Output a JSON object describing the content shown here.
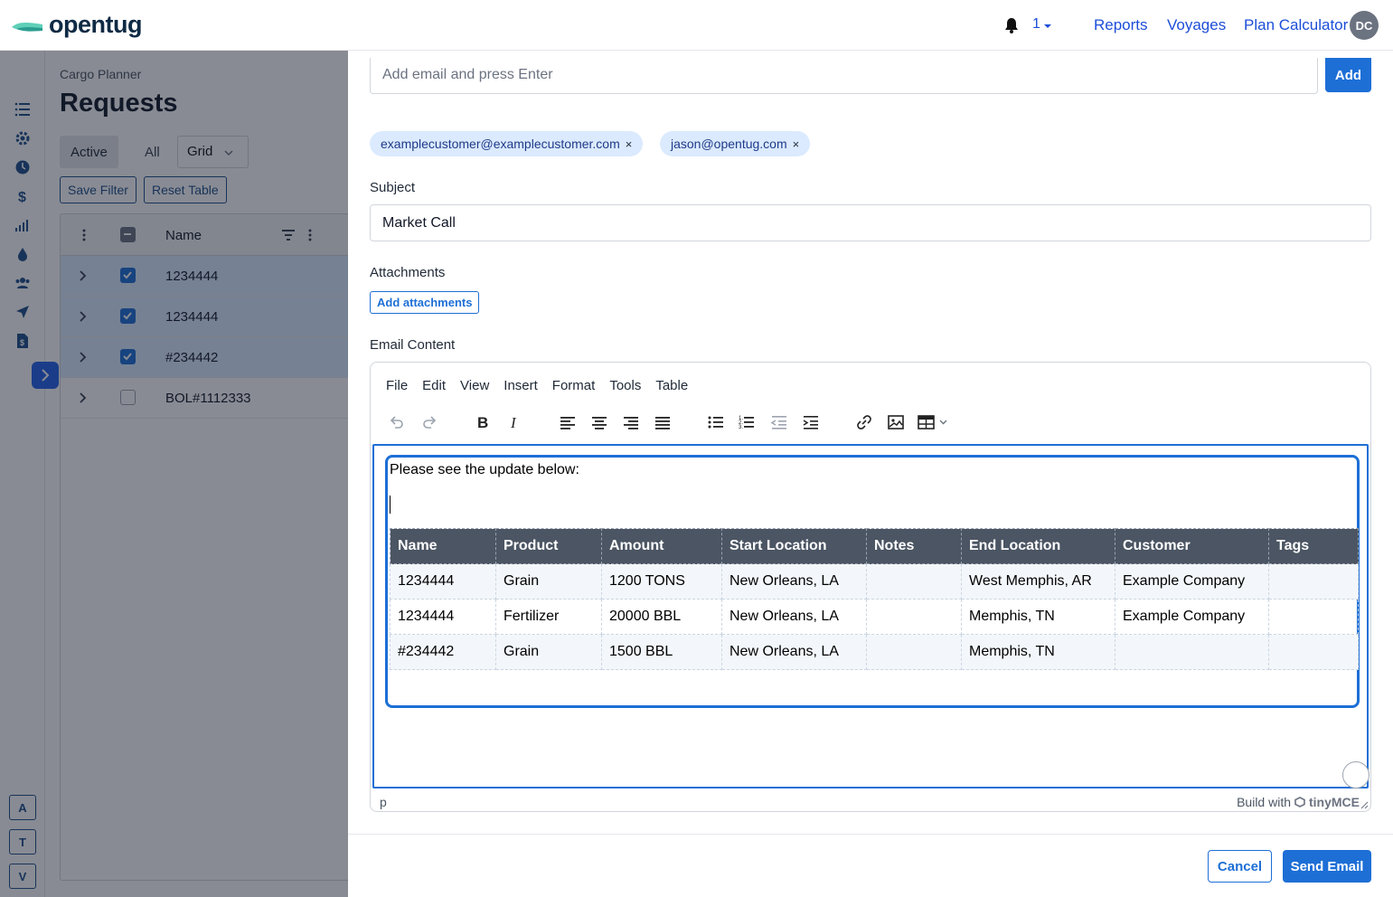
{
  "app": {
    "logo_text": "opentug"
  },
  "topbar": {
    "notification_count": "1",
    "nav": [
      "Reports",
      "Voyages",
      "Plan Calculator"
    ],
    "avatar_initials": "DC"
  },
  "background": {
    "breadcrumb": "Cargo Planner",
    "title": "Requests",
    "segments": [
      "Active",
      "All"
    ],
    "view_select": "Grid",
    "buttons": [
      "Save Filter",
      "Reset Table"
    ],
    "table_header": "Name",
    "rows": [
      {
        "name": "1234444",
        "checked": true
      },
      {
        "name": "1234444",
        "checked": true
      },
      {
        "name": "#234442",
        "checked": true
      },
      {
        "name": "BOL#1112333",
        "checked": false
      }
    ],
    "sidebar_letters": [
      "A",
      "T",
      "V"
    ]
  },
  "email": {
    "recipient_placeholder": "Add email and press Enter",
    "add_label": "Add",
    "recipients": [
      "examplecustomer@examplecustomer.com",
      "jason@opentug.com"
    ],
    "remove_glyph": "×",
    "subject_label": "Subject",
    "subject_value": "Market Call",
    "attachments_label": "Attachments",
    "add_attachments_label": "Add attachments",
    "content_label": "Email Content",
    "menu": [
      "File",
      "Edit",
      "View",
      "Insert",
      "Format",
      "Tools",
      "Table"
    ],
    "intro_text": "Please see the update below:",
    "table": {
      "headers": [
        "Name",
        "Product",
        "Amount",
        "Start Location",
        "Notes",
        "End Location",
        "Customer",
        "Tags"
      ],
      "rows": [
        [
          "1234444",
          "Grain",
          "1200 TONS",
          "New Orleans, LA",
          "",
          "West Memphis, AR",
          "Example Company",
          ""
        ],
        [
          "1234444",
          "Fertilizer",
          "20000 BBL",
          "New Orleans, LA",
          "",
          "Memphis, TN",
          "Example Company",
          ""
        ],
        [
          "#234442",
          "Grain",
          "1500 BBL",
          "New Orleans, LA",
          "",
          "Memphis, TN",
          "",
          ""
        ]
      ]
    },
    "status_path": "p",
    "status_build": "Build with",
    "status_brand": "tinyMCE",
    "cancel_label": "Cancel",
    "send_label": "Send Email"
  },
  "colors": {
    "accent": "#1d6fd6",
    "table_header_bg": "#4b5563",
    "chip_bg": "#dbeafe"
  }
}
